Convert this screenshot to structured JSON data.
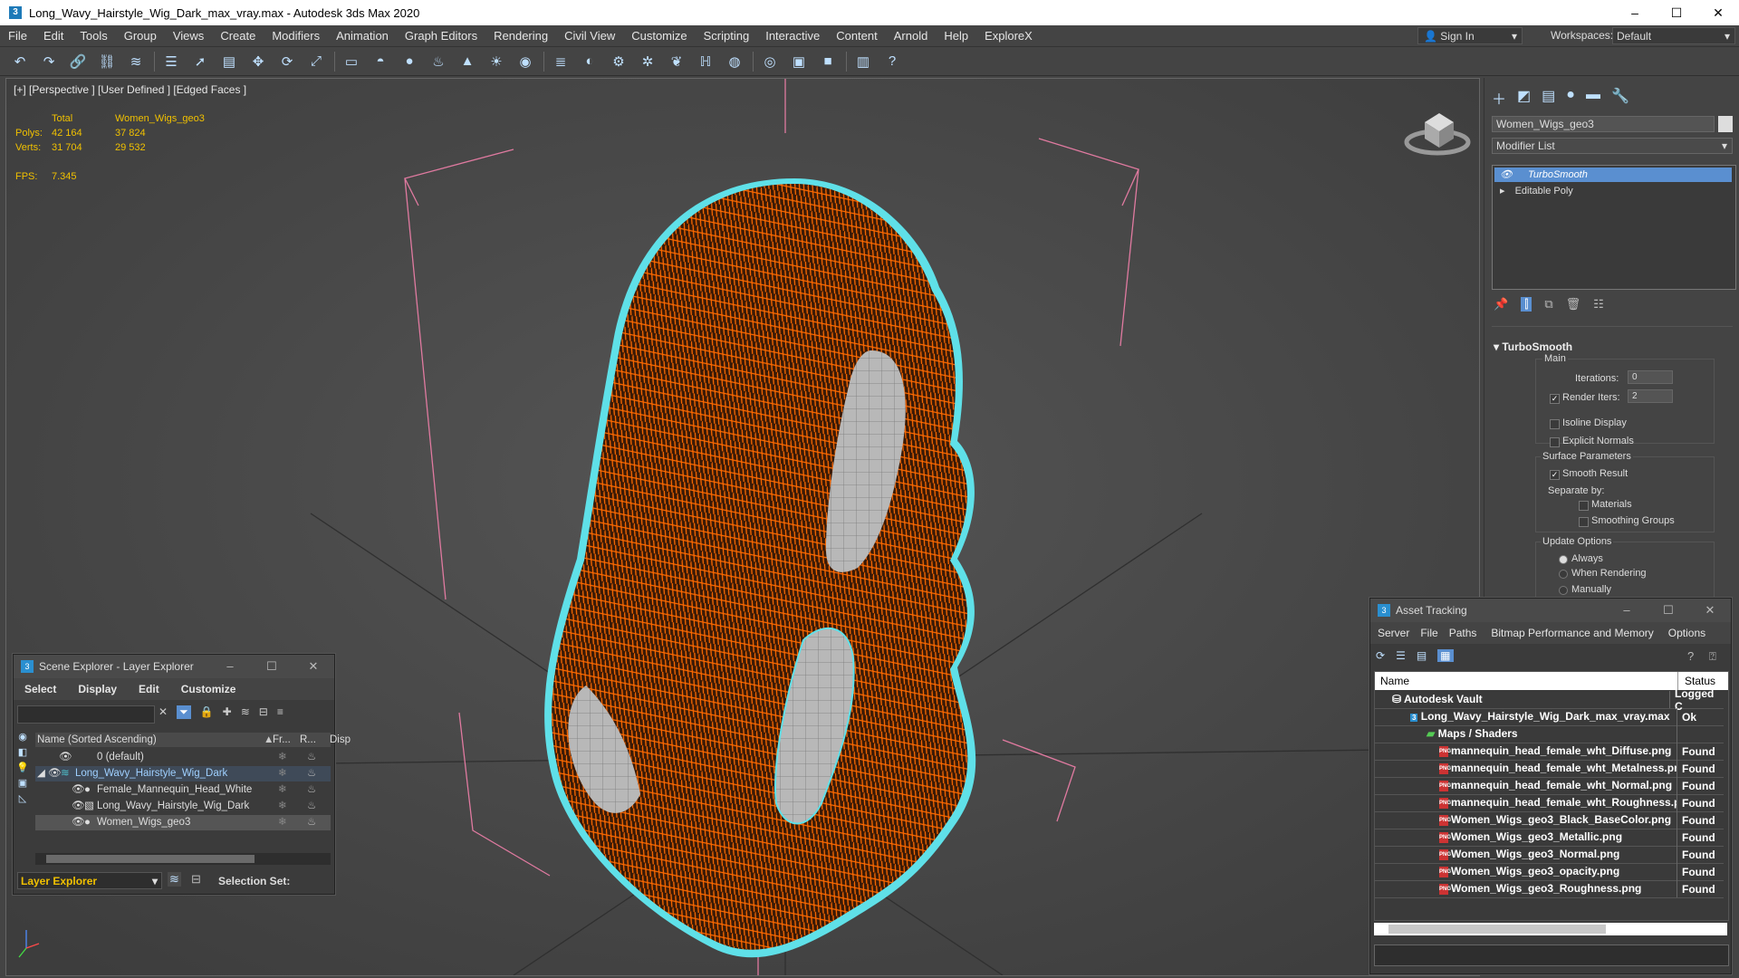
{
  "window": {
    "title": "Long_Wavy_Hairstyle_Wig_Dark_max_vray.max - Autodesk 3ds Max 2020",
    "controls": [
      "–",
      "☐",
      "✕"
    ]
  },
  "menu": {
    "items": [
      "File",
      "Edit",
      "Tools",
      "Group",
      "Views",
      "Create",
      "Modifiers",
      "Animation",
      "Graph Editors",
      "Rendering",
      "Civil View",
      "Customize",
      "Scripting",
      "Interactive",
      "Content",
      "Arnold",
      "Help",
      "ExploreX"
    ],
    "sign_in": "Sign In",
    "workspaces_label": "Workspaces:",
    "workspace_value": "Default"
  },
  "viewport": {
    "label": "[+] [Perspective ] [User Defined ] [Edged Faces ]",
    "stats": {
      "col_total": "Total",
      "col_object": "Women_Wigs_geo3",
      "polys_label": "Polys:",
      "polys_total": "42 164",
      "polys_object": "37 824",
      "verts_label": "Verts:",
      "verts_total": "31 704",
      "verts_object": "29 532",
      "fps_label": "FPS:",
      "fps_value": "7.345"
    },
    "colors": {
      "hair": "#ff6a00",
      "outline": "#5fe0e8",
      "grid": "#2e2e2e",
      "bbox": "#e07aa0"
    }
  },
  "command_panel": {
    "object_name": "Women_Wigs_geo3",
    "modifier_list": "Modifier List",
    "stack": [
      "TurboSmooth",
      "Editable Poly"
    ],
    "rollout_title": "TurboSmooth",
    "main_label": "Main",
    "iterations_label": "Iterations:",
    "iterations_value": "0",
    "render_iters_label": "Render Iters:",
    "render_iters_value": "2",
    "isoline_label": "Isoline Display",
    "explicit_label": "Explicit Normals",
    "surface_label": "Surface Parameters",
    "smooth_label": "Smooth Result",
    "separate_label": "Separate by:",
    "materials_label": "Materials",
    "smoothing_label": "Smoothing Groups",
    "update_label": "Update Options",
    "always_label": "Always",
    "when_rendering_label": "When Rendering",
    "manually_label": "Manually"
  },
  "scene_explorer": {
    "title": "Scene Explorer - Layer Explorer",
    "menu": [
      "Select",
      "Display",
      "Edit",
      "Customize"
    ],
    "col_name": "Name (Sorted Ascending)",
    "col_fr": "Fr...",
    "col_r": "R...",
    "col_disp": "Disp",
    "rows": [
      "0 (default)",
      "Long_Wavy_Hairstyle_Wig_Dark",
      "Female_Mannequin_Head_White",
      "Long_Wavy_Hairstyle_Wig_Dark",
      "Women_Wigs_geo3"
    ],
    "footer_layer": "Layer Explorer",
    "footer_selection": "Selection Set:"
  },
  "asset_tracking": {
    "title": "Asset Tracking",
    "menu": [
      "Server",
      "File",
      "Paths",
      "Bitmap Performance and Memory",
      "Options"
    ],
    "col_name": "Name",
    "col_status": "Status",
    "rows": [
      {
        "name": "Autodesk Vault",
        "status": "Logged C"
      },
      {
        "name": "Long_Wavy_Hairstyle_Wig_Dark_max_vray.max",
        "status": "Ok"
      },
      {
        "name": "Maps / Shaders",
        "status": ""
      },
      {
        "name": "mannequin_head_female_wht_Diffuse.png",
        "status": "Found"
      },
      {
        "name": "mannequin_head_female_wht_Metalness.png",
        "status": "Found"
      },
      {
        "name": "mannequin_head_female_wht_Normal.png",
        "status": "Found"
      },
      {
        "name": "mannequin_head_female_wht_Roughness.png",
        "status": "Found"
      },
      {
        "name": "Women_Wigs_geo3_Black_BaseColor.png",
        "status": "Found"
      },
      {
        "name": "Women_Wigs_geo3_Metallic.png",
        "status": "Found"
      },
      {
        "name": "Women_Wigs_geo3_Normal.png",
        "status": "Found"
      },
      {
        "name": "Women_Wigs_geo3_opacity.png",
        "status": "Found"
      },
      {
        "name": "Women_Wigs_geo3_Roughness.png",
        "status": "Found"
      }
    ]
  }
}
